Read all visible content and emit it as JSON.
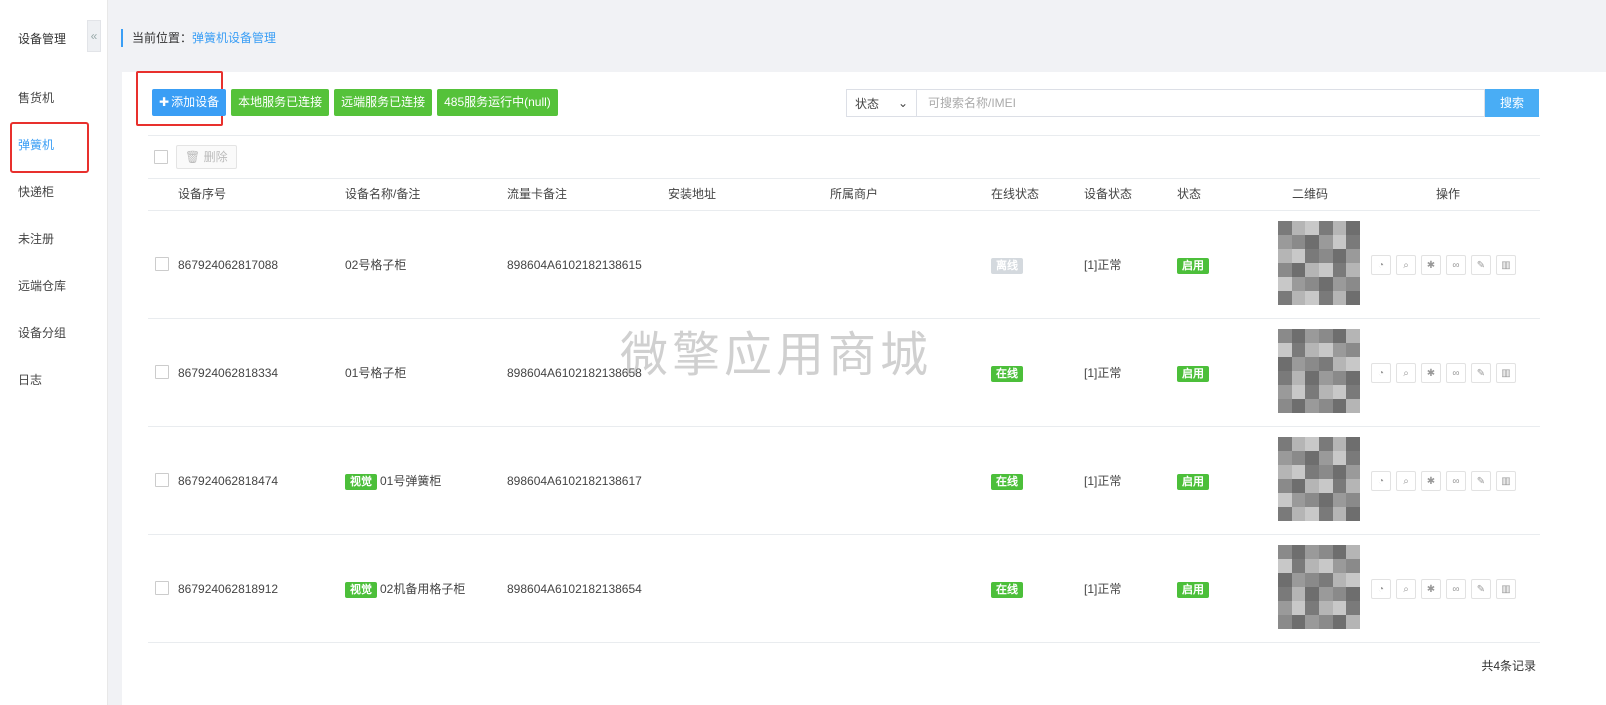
{
  "sidebar": {
    "title": "设备管理",
    "collapse_icon": "«",
    "items": [
      {
        "label": "售货机"
      },
      {
        "label": "弹簧机",
        "active": true
      },
      {
        "label": "快递柜"
      },
      {
        "label": "未注册"
      },
      {
        "label": "远端仓库"
      },
      {
        "label": "设备分组"
      },
      {
        "label": "日志"
      }
    ]
  },
  "breadcrumb": {
    "prefix": "当前位置：",
    "current": "弹簧机设备管理"
  },
  "toolbar": {
    "add_label": "添加设备",
    "add_icon": "plus-icon",
    "status_buttons": [
      "本地服务已连接",
      "远端服务已连接",
      "485服务运行中(null)"
    ]
  },
  "search": {
    "select_value": "状态",
    "placeholder": "可搜索名称/IMEI",
    "button_label": "搜索"
  },
  "delete_label": "删除",
  "table": {
    "headers": [
      "设备序号",
      "设备名称/备注",
      "流量卡备注",
      "安装地址",
      "所属商户",
      "在线状态",
      "设备状态",
      "状态",
      "二维码",
      "操作"
    ],
    "rows": [
      {
        "serial": "867924062817088",
        "tag": "",
        "name": "02号格子柜",
        "sim": "898604A6102182138615",
        "address": "",
        "merchant": "",
        "online": "离线",
        "online_ok": false,
        "device_status": "[1]正常",
        "state": "启用"
      },
      {
        "serial": "867924062818334",
        "tag": "",
        "name": "01号格子柜",
        "sim": "898604A6102182138658",
        "address": "",
        "merchant": "",
        "online": "在线",
        "online_ok": true,
        "device_status": "[1]正常",
        "state": "启用"
      },
      {
        "serial": "867924062818474",
        "tag": "视觉",
        "name": "01号弹簧柜",
        "sim": "898604A6102182138617",
        "address": "",
        "merchant": "",
        "online": "在线",
        "online_ok": true,
        "device_status": "[1]正常",
        "state": "启用"
      },
      {
        "serial": "867924062818912",
        "tag": "视觉",
        "name": "02机备用格子柜",
        "sim": "898604A6102182138654",
        "address": "",
        "merchant": "",
        "online": "在线",
        "online_ok": true,
        "device_status": "[1]正常",
        "state": "启用"
      }
    ],
    "op_icons": [
      "chart-icon",
      "search-icon",
      "gear-icon",
      "link-icon",
      "edit-icon",
      "trash-icon"
    ]
  },
  "footer": {
    "count_text": "共4条记录"
  },
  "watermark": "微擎应用商城",
  "colors": {
    "primary": "#3a9ef5",
    "success": "#55c23a",
    "highlight": "#e8302d"
  }
}
